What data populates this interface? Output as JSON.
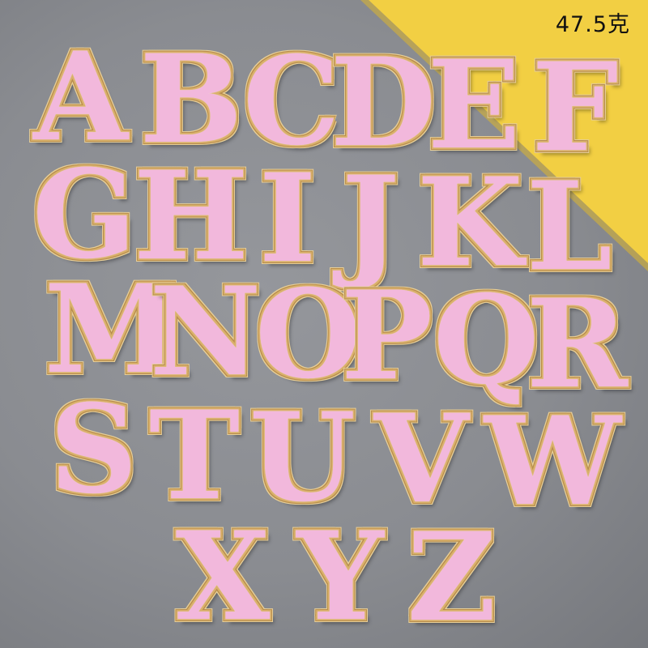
{
  "photo": {
    "weight_label": "47.5克",
    "background_color": "#8a8c91",
    "corner_color": "#f2cf43",
    "patch_color": "#f2b8dc",
    "border_color": "#d9b06a"
  },
  "patches": [
    "A",
    "B",
    "C",
    "D",
    "E",
    "F",
    "G",
    "H",
    "I",
    "J",
    "K",
    "L",
    "M",
    "N",
    "O",
    "P",
    "Q",
    "R",
    "S",
    "T",
    "U",
    "V",
    "W",
    "X",
    "Y",
    "Z"
  ]
}
